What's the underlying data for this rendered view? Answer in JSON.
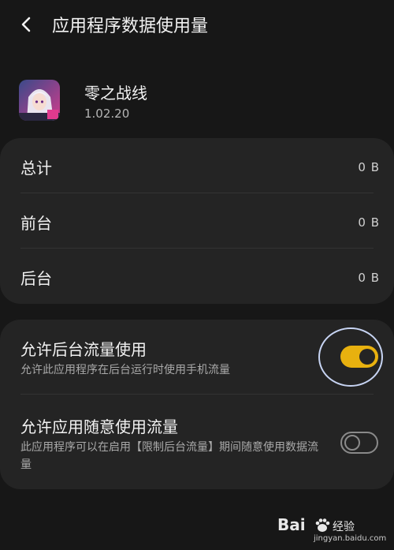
{
  "header": {
    "title": "应用程序数据使用量"
  },
  "app": {
    "name": "零之战线",
    "version": "1.02.20"
  },
  "usage": [
    {
      "label": "总计",
      "value": "0 B"
    },
    {
      "label": "前台",
      "value": "0 B"
    },
    {
      "label": "后台",
      "value": "0 B"
    }
  ],
  "settings": [
    {
      "title": "允许后台流量使用",
      "desc": "允许此应用程序在后台运行时使用手机流量",
      "enabled": true
    },
    {
      "title": "允许应用随意使用流量",
      "desc": "此应用程序可以在启用【限制后台流量】期间随意使用数据流量",
      "enabled": false
    }
  ],
  "colors": {
    "accent": "#e8b10f",
    "background": "#171717",
    "card": "#242424"
  },
  "watermark": {
    "logo": "Bai",
    "text": "经验",
    "url": "jingyan.baidu.com"
  }
}
